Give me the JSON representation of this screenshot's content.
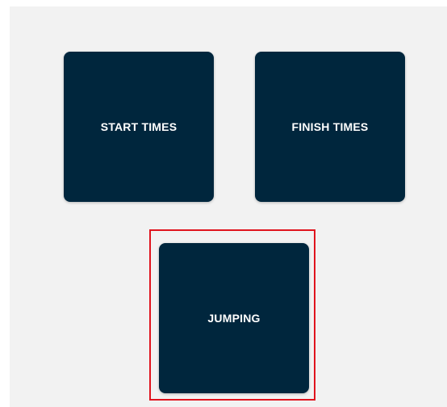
{
  "tiles": [
    {
      "label": "START TIMES"
    },
    {
      "label": "FINISH TIMES"
    },
    {
      "label": "JUMPING"
    }
  ],
  "colors": {
    "tile_background": "#00263d",
    "panel_background": "#f2f2f2",
    "highlight_border": "#e0141e",
    "label_text": "#ffffff"
  }
}
